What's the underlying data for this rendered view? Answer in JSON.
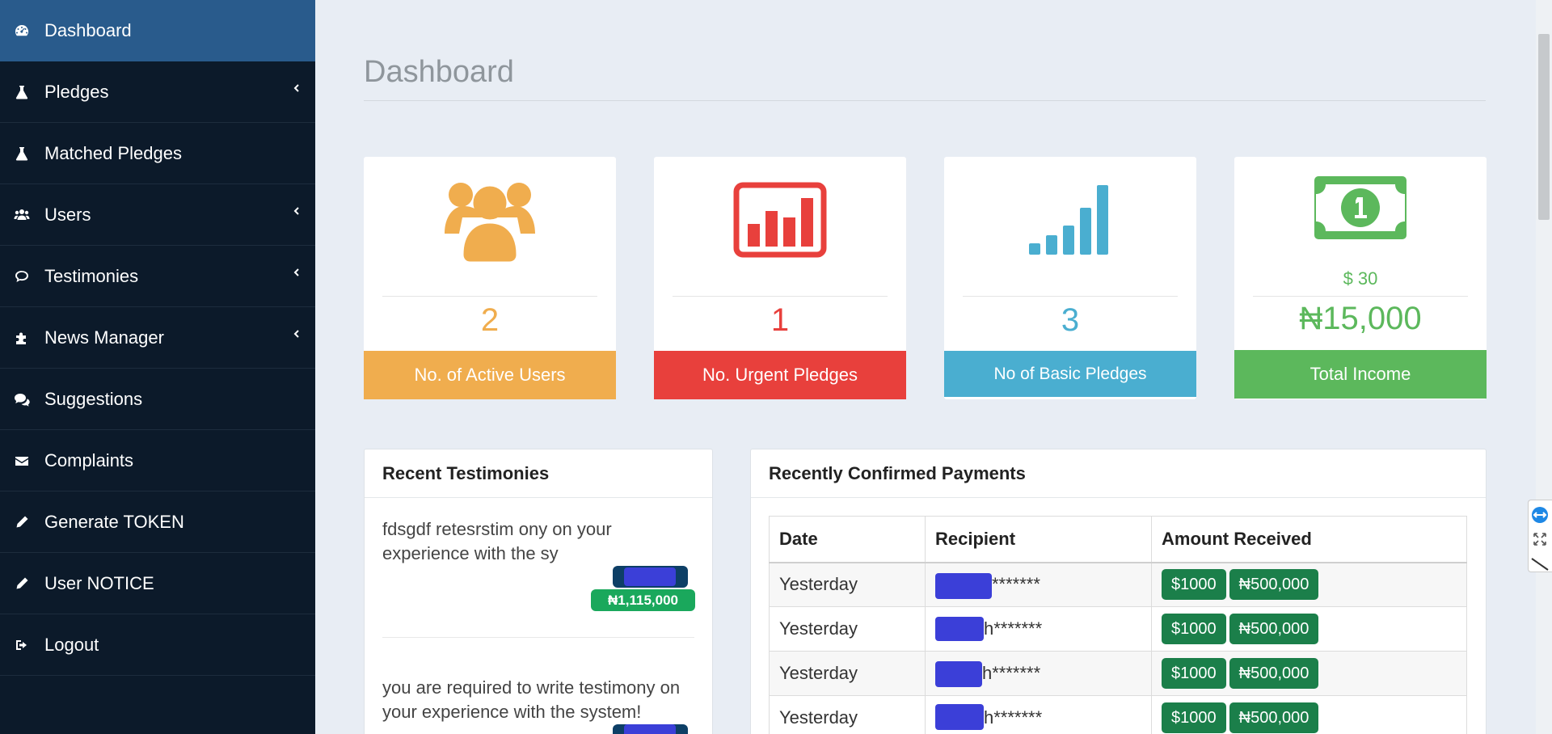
{
  "sidebar": {
    "items": [
      {
        "label": "Dashboard",
        "icon": "dashboard-icon",
        "active": true,
        "chevron": false
      },
      {
        "label": "Pledges",
        "icon": "flask-icon",
        "active": false,
        "chevron": true
      },
      {
        "label": "Matched Pledges",
        "icon": "flask-icon",
        "active": false,
        "chevron": false
      },
      {
        "label": "Users",
        "icon": "users-icon",
        "active": false,
        "chevron": true
      },
      {
        "label": "Testimonies",
        "icon": "comment-icon",
        "active": false,
        "chevron": true
      },
      {
        "label": "News Manager",
        "icon": "puzzle-icon",
        "active": false,
        "chevron": true
      },
      {
        "label": "Suggestions",
        "icon": "comments-icon",
        "active": false,
        "chevron": false
      },
      {
        "label": "Complaints",
        "icon": "envelope-icon",
        "active": false,
        "chevron": false
      },
      {
        "label": "Generate TOKEN",
        "icon": "pencil-icon",
        "active": false,
        "chevron": false
      },
      {
        "label": "User NOTICE",
        "icon": "pencil-icon",
        "active": false,
        "chevron": false
      },
      {
        "label": "Logout",
        "icon": "sign-out-icon",
        "active": false,
        "chevron": false
      }
    ]
  },
  "page": {
    "title": "Dashboard"
  },
  "stats": {
    "active_users": {
      "value": "2",
      "label": "No. of Active Users",
      "color": "#f0ad4e"
    },
    "urgent_pledges": {
      "value": "1",
      "label": "No. Urgent Pledges",
      "color": "#e8403c"
    },
    "basic_pledges": {
      "value": "3",
      "label": "No of Basic Pledges",
      "color": "#4aaed0"
    },
    "total_income": {
      "usd": "$ 30",
      "value": "₦15,000",
      "label": "Total Income",
      "color": "#5cb85c"
    }
  },
  "testimonies": {
    "title": "Recent Testimonies",
    "items": [
      {
        "text": "fdsgdf retesrstim ony on your experience with the sy",
        "amount": "₦1,115,000"
      },
      {
        "text": "you are required to write testimony on your experience with the system!",
        "amount": ""
      }
    ]
  },
  "payments": {
    "title": "Recently Confirmed Payments",
    "headers": [
      "Date",
      "Recipient",
      "Amount Received"
    ],
    "rows": [
      {
        "date": "Yesterday",
        "recipient": "*******",
        "usd": "$1000",
        "ngn": "₦500,000"
      },
      {
        "date": "Yesterday",
        "recipient": "h*******",
        "usd": "$1000",
        "ngn": "₦500,000"
      },
      {
        "date": "Yesterday",
        "recipient": "h*******",
        "usd": "$1000",
        "ngn": "₦500,000"
      },
      {
        "date": "Yesterday",
        "recipient": "h*******",
        "usd": "$1000",
        "ngn": "₦500,000"
      }
    ]
  }
}
